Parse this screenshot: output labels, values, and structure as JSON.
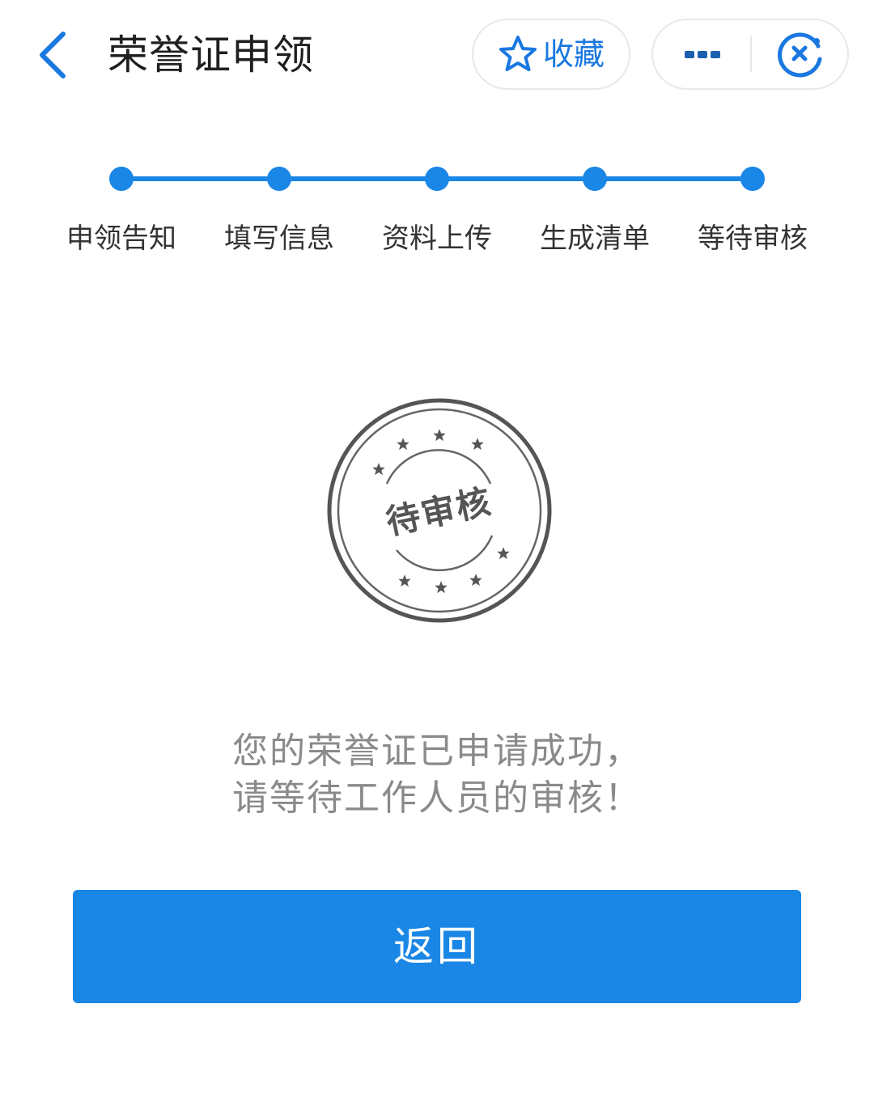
{
  "header": {
    "title": "荣誉证申领",
    "favorite_label": "收藏"
  },
  "steps": [
    {
      "label": "申领告知"
    },
    {
      "label": "填写信息"
    },
    {
      "label": "资料上传"
    },
    {
      "label": "生成清单"
    },
    {
      "label": "等待审核"
    }
  ],
  "stamp": {
    "text": "待审核"
  },
  "message": {
    "line1": "您的荣誉证已申请成功，",
    "line2": "请等待工作人员的审核！"
  },
  "return_button": {
    "label": "返回"
  },
  "colors": {
    "accent": "#1a86e6",
    "icon_blue": "#1a78e0",
    "message_gray": "#8a8a8a",
    "stamp_gray": "#555555"
  },
  "icons": {
    "back": "chevron-left-icon",
    "favorite": "star-outline-icon",
    "more": "more-dots-icon",
    "close": "close-circle-icon"
  }
}
